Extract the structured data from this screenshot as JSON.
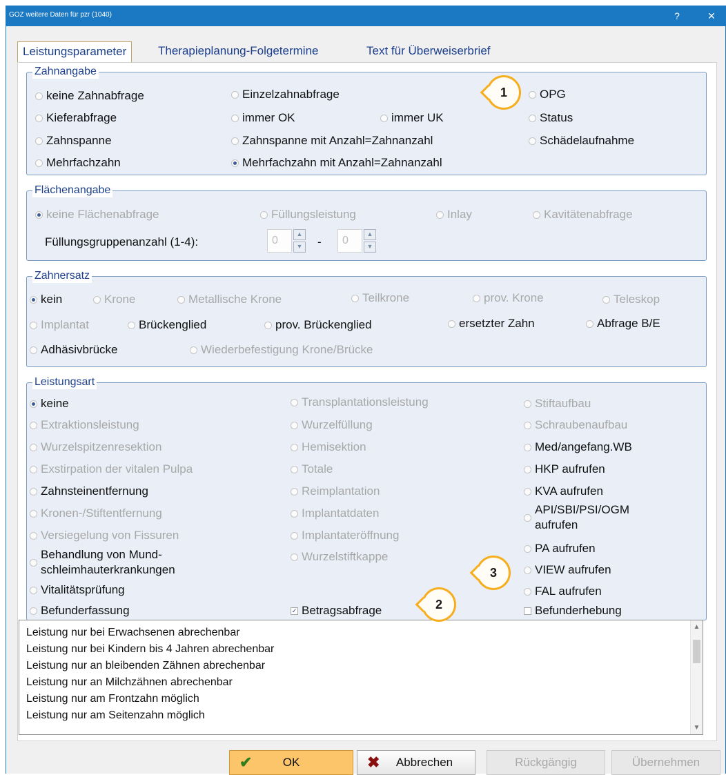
{
  "window": {
    "title": "GOZ weitere Daten für pzr (1040)",
    "help_glyph": "?",
    "close_glyph": "✕"
  },
  "tabs": [
    {
      "label": "Leistungsparameter",
      "active": true
    },
    {
      "label": "Therapieplanung-Folgetermine",
      "active": false
    },
    {
      "label": "Text für Überweiserbrief",
      "active": false
    }
  ],
  "zahnangabe": {
    "legend": "Zahnangabe",
    "options": [
      {
        "label": "keine Zahnabfrage",
        "selected": false,
        "enabled": true
      },
      {
        "label": "Einzelzahnabfrage",
        "selected": false,
        "enabled": true
      },
      {
        "label": "OPG",
        "selected": false,
        "enabled": true
      },
      {
        "label": "Kieferabfrage",
        "selected": false,
        "enabled": true
      },
      {
        "label": "immer OK",
        "selected": false,
        "enabled": true
      },
      {
        "label": "immer UK",
        "selected": false,
        "enabled": true
      },
      {
        "label": "Status",
        "selected": false,
        "enabled": true
      },
      {
        "label": "Zahnspanne",
        "selected": false,
        "enabled": true
      },
      {
        "label": "Zahnspanne mit Anzahl=Zahnanzahl",
        "selected": false,
        "enabled": true
      },
      {
        "label": "Schädelaufnahme",
        "selected": false,
        "enabled": true
      },
      {
        "label": "Mehrfachzahn",
        "selected": false,
        "enabled": true
      },
      {
        "label": "Mehrfachzahn mit Anzahl=Zahnanzahl",
        "selected": true,
        "enabled": true
      }
    ]
  },
  "flaechenangabe": {
    "legend": "Flächenangabe",
    "options": [
      {
        "label": "keine Flächenabfrage",
        "selected": true,
        "enabled": false
      },
      {
        "label": "Füllungsleistung",
        "selected": false,
        "enabled": false
      },
      {
        "label": "Inlay",
        "selected": false,
        "enabled": false
      },
      {
        "label": "Kavitätenabfrage",
        "selected": false,
        "enabled": false
      }
    ],
    "group_count_label": "Füllungsgruppenanzahl (1-4):",
    "from_value": "0",
    "to_value": "0",
    "separator": "-"
  },
  "zahnersatz": {
    "legend": "Zahnersatz",
    "options": [
      {
        "label": "kein",
        "selected": true,
        "enabled": true
      },
      {
        "label": "Krone",
        "selected": false,
        "enabled": false
      },
      {
        "label": "Metallische Krone",
        "selected": false,
        "enabled": false
      },
      {
        "label": "Teilkrone",
        "selected": false,
        "enabled": false
      },
      {
        "label": "prov. Krone",
        "selected": false,
        "enabled": false
      },
      {
        "label": "Teleskop",
        "selected": false,
        "enabled": false
      },
      {
        "label": "Implantat",
        "selected": false,
        "enabled": false
      },
      {
        "label": "Brückenglied",
        "selected": false,
        "enabled": true
      },
      {
        "label": "prov. Brückenglied",
        "selected": false,
        "enabled": true
      },
      {
        "label": "ersetzter Zahn",
        "selected": false,
        "enabled": true
      },
      {
        "label": "Abfrage B/E",
        "selected": false,
        "enabled": true
      },
      {
        "label": "Adhäsivbrücke",
        "selected": false,
        "enabled": true
      },
      {
        "label": "Wiederbefestigung Krone/Brücke",
        "selected": false,
        "enabled": false
      }
    ]
  },
  "leistungsart": {
    "legend": "Leistungsart",
    "col1": [
      {
        "label": "keine",
        "selected": true,
        "enabled": true
      },
      {
        "label": "Extraktionsleistung",
        "selected": false,
        "enabled": false
      },
      {
        "label": "Wurzelspitzenresektion",
        "selected": false,
        "enabled": false
      },
      {
        "label": "Exstirpation der vitalen Pulpa",
        "selected": false,
        "enabled": false
      },
      {
        "label": "Zahnsteinentfernung",
        "selected": false,
        "enabled": true
      },
      {
        "label": "Kronen-/Stiftentfernung",
        "selected": false,
        "enabled": false
      },
      {
        "label": "Versiegelung von Fissuren",
        "selected": false,
        "enabled": false
      },
      {
        "label": "Behandlung von Mund-",
        "label2": "schleimhauterkrankungen",
        "selected": false,
        "enabled": true
      },
      {
        "label": "Vitalitätsprüfung",
        "selected": false,
        "enabled": true
      },
      {
        "label": "Befunderfassung",
        "selected": false,
        "enabled": true
      }
    ],
    "col2": [
      {
        "label": "Transplantationsleistung",
        "selected": false,
        "enabled": false
      },
      {
        "label": "Wurzelfüllung",
        "selected": false,
        "enabled": false
      },
      {
        "label": "Hemisektion",
        "selected": false,
        "enabled": false
      },
      {
        "label": "Totale",
        "selected": false,
        "enabled": false
      },
      {
        "label": "Reimplantation",
        "selected": false,
        "enabled": false
      },
      {
        "label": "Implantatdaten",
        "selected": false,
        "enabled": false
      },
      {
        "label": "Implantateröffnung",
        "selected": false,
        "enabled": false
      },
      {
        "label": "Wurzelstiftkappe",
        "selected": false,
        "enabled": false
      }
    ],
    "col3": [
      {
        "label": "Stiftaufbau",
        "selected": false,
        "enabled": false
      },
      {
        "label": "Schraubenaufbau",
        "selected": false,
        "enabled": false
      },
      {
        "label": "Med/angefang.WB",
        "selected": false,
        "enabled": true
      },
      {
        "label": "HKP aufrufen",
        "selected": false,
        "enabled": true
      },
      {
        "label": "KVA aufrufen",
        "selected": false,
        "enabled": true
      },
      {
        "label": "API/SBI/PSI/OGM",
        "label2": "aufrufen",
        "selected": false,
        "enabled": true
      },
      {
        "label": "PA aufrufen",
        "selected": false,
        "enabled": true
      },
      {
        "label": "VIEW aufrufen",
        "selected": false,
        "enabled": true
      },
      {
        "label": "FAL aufrufen",
        "selected": false,
        "enabled": true
      }
    ],
    "checkboxes": [
      {
        "label": "Betragsabfrage",
        "checked": true
      },
      {
        "label": "Befunderhebung",
        "checked": false
      }
    ]
  },
  "text_list": [
    "Leistung nur bei Erwachsenen abrechenbar",
    "Leistung nur bei Kindern bis 4 Jahren abrechenbar",
    "Leistung nur an bleibenden Zähnen abrechenbar",
    "Leistung nur an Milchzähnen abrechenbar",
    "Leistung nur am Frontzahn möglich",
    "Leistung nur am Seitenzahn möglich"
  ],
  "buttons": {
    "ok": "OK",
    "cancel": "Abbrechen",
    "undo": "Rückgängig",
    "apply": "Übernehmen"
  },
  "callouts": [
    "1",
    "2",
    "3"
  ],
  "colors": {
    "titlebar": "#1b78c2",
    "callout_border": "#f6ae1e",
    "ok_button": "#fcc56a",
    "group_fill": "#e9eef7"
  }
}
